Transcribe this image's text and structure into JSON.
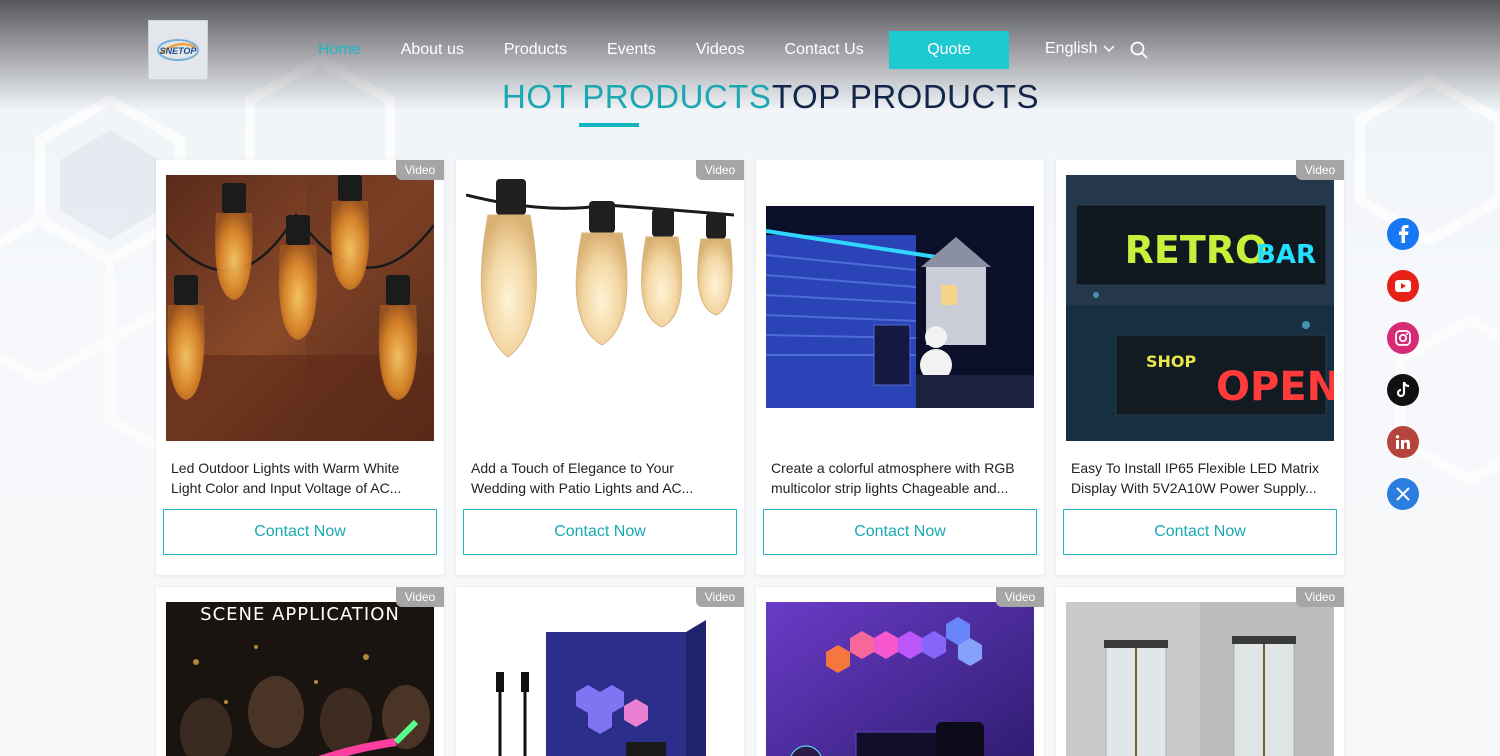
{
  "brand": {
    "logo_text": "SNETOP"
  },
  "nav": {
    "items": [
      {
        "label": "Home",
        "active": true
      },
      {
        "label": "About us",
        "active": false
      },
      {
        "label": "Products",
        "active": false
      },
      {
        "label": "Events",
        "active": false
      },
      {
        "label": "Videos",
        "active": false
      },
      {
        "label": "Contact Us",
        "active": false
      }
    ],
    "quote_label": "Quote",
    "language": "English"
  },
  "section": {
    "hot_label": "HOT PRODUCTS",
    "top_label": "TOP PRODUCTS"
  },
  "products": [
    {
      "badge": "Video",
      "title": "Led Outdoor Lights with Warm White Light Color and Input Voltage of AC...",
      "button": "Contact Now",
      "image": "edison-bulb-string-lights-warm"
    },
    {
      "badge": "Video",
      "title": "Add a Touch of Elegance to Your Wedding with Patio Lights and AC...",
      "button": "Contact Now",
      "image": "clear-bulb-string-lights"
    },
    {
      "badge": "",
      "title": "Create a colorful atmosphere with RGB multicolor strip lights Chageable and...",
      "button": "Contact Now",
      "image": "blue-house-eave-lights-night"
    },
    {
      "badge": "Video",
      "title": "Easy To Install IP65 Flexible LED Matrix Display With 5V2A10W Power Supply...",
      "button": "Contact Now",
      "image": "retro-bar-shop-open-led-signs"
    },
    {
      "badge": "Video",
      "title": "",
      "button": "",
      "image": "scene-application-party",
      "image_text": "SCENE APPLICATION"
    },
    {
      "badge": "Video",
      "title": "",
      "button": "",
      "image": "hexagon-light-panels-box"
    },
    {
      "badge": "Video",
      "title": "",
      "button": "",
      "image": "hexagon-wall-lights-gaming-room"
    },
    {
      "badge": "Video",
      "title": "",
      "button": "",
      "image": "glass-tube-lamps"
    }
  ],
  "social": [
    {
      "name": "facebook",
      "color": "#1877f2"
    },
    {
      "name": "youtube",
      "color": "#e62117"
    },
    {
      "name": "instagram",
      "color": "#d62976"
    },
    {
      "name": "tiktok",
      "color": "#111111"
    },
    {
      "name": "linkedin",
      "color": "#b5443c"
    },
    {
      "name": "x",
      "color": "#2b7de0"
    }
  ],
  "colors": {
    "accent": "#1aa9b3",
    "quote_bg": "#1ec9cf",
    "heading_dark": "#13264a"
  }
}
